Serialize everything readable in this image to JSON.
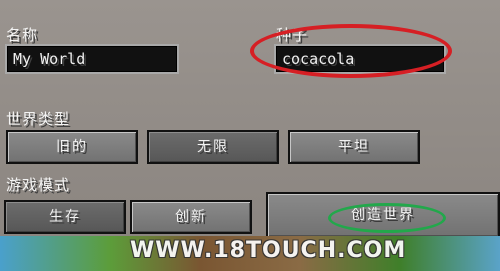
{
  "name_label": "名称",
  "world_name_value": "My World",
  "seed_label": "种子",
  "seed_value": "cocacola",
  "world_type_label": "世界类型",
  "world_types": [
    "旧的",
    "无限",
    "平坦"
  ],
  "selected_world_type": "无限",
  "game_mode_label": "游戏模式",
  "game_modes": [
    "生存",
    "创新"
  ],
  "selected_game_mode": "生存",
  "create_world_button": "创造世界",
  "watermark": "WWW.18TOUCH.COM",
  "colors": {
    "seed_highlight": "#d61f24",
    "create_highlight": "#22a84b"
  }
}
